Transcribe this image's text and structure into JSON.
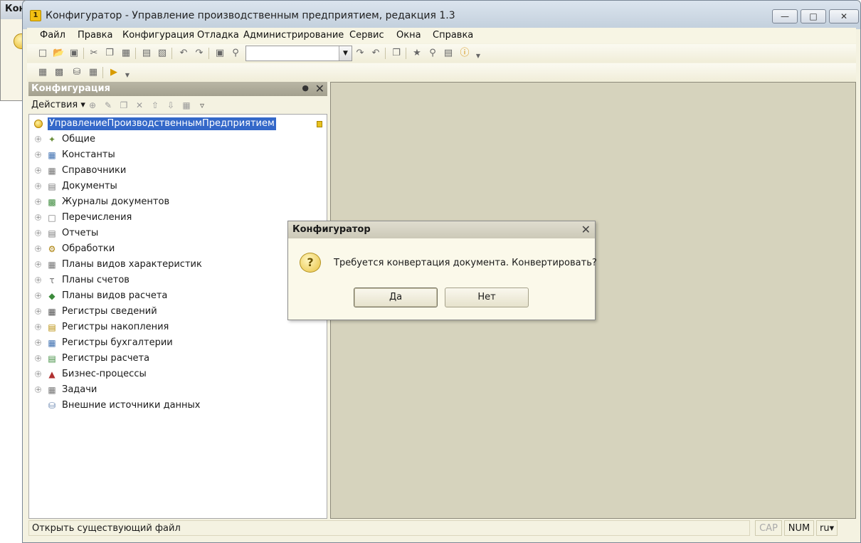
{
  "background_window": {
    "title": "Кон"
  },
  "window": {
    "title": "Конфигуратор - Управление производственным предприятием, редакция 1.3"
  },
  "menu": [
    "Файл",
    "Правка",
    "Конфигурация",
    "Отладка",
    "Администрирование",
    "Сервис",
    "Окна",
    "Справка"
  ],
  "panel": {
    "title": "Конфигурация",
    "actions_label": "Действия",
    "root": "УправлениеПроизводственнымПредприятием",
    "items": [
      {
        "label": "Общие",
        "icon": "common-icon"
      },
      {
        "label": "Константы",
        "icon": "constants-icon"
      },
      {
        "label": "Справочники",
        "icon": "catalogs-icon"
      },
      {
        "label": "Документы",
        "icon": "documents-icon"
      },
      {
        "label": "Журналы документов",
        "icon": "journals-icon"
      },
      {
        "label": "Перечисления",
        "icon": "enums-icon"
      },
      {
        "label": "Отчеты",
        "icon": "reports-icon"
      },
      {
        "label": "Обработки",
        "icon": "processing-icon"
      },
      {
        "label": "Планы видов характеристик",
        "icon": "characteristics-icon"
      },
      {
        "label": "Планы счетов",
        "icon": "accounts-icon"
      },
      {
        "label": "Планы видов расчета",
        "icon": "calculation-types-icon"
      },
      {
        "label": "Регистры сведений",
        "icon": "info-registers-icon"
      },
      {
        "label": "Регистры накопления",
        "icon": "accumulation-registers-icon"
      },
      {
        "label": "Регистры бухгалтерии",
        "icon": "accounting-registers-icon"
      },
      {
        "label": "Регистры расчета",
        "icon": "calculation-registers-icon"
      },
      {
        "label": "Бизнес-процессы",
        "icon": "business-processes-icon"
      },
      {
        "label": "Задачи",
        "icon": "tasks-icon"
      },
      {
        "label": "Внешние источники данных",
        "icon": "external-sources-icon"
      }
    ]
  },
  "statusbar": {
    "text": "Открыть существующий файл",
    "cap": "CAP",
    "num": "NUM",
    "lang": "ru"
  },
  "dialog": {
    "title": "Конфигуратор",
    "message": "Требуется конвертация документа. Конвертировать?",
    "yes": "Да",
    "no": "Нет"
  }
}
